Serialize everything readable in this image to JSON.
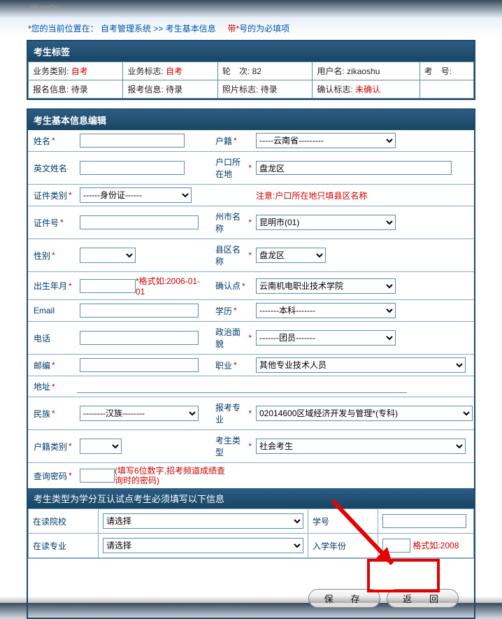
{
  "topuser": "zikaoshu、",
  "crumb": {
    "prefix": "*",
    "label": "您的当前位置在：",
    "p1": "自考管理系统",
    "sep": " >> ",
    "p2": "考生基本信息",
    "tail_star": "带*",
    "tail_text": "号的为必填项"
  },
  "tag": {
    "title": "考生标签",
    "r1": {
      "c1l": "业务类别:",
      "c1v": "自考",
      "c2l": "业务标志:",
      "c2v": "自考",
      "c3l": "轮　次:",
      "c3v": "82",
      "c4l": "用户名:",
      "c4v": "zikaoshu",
      "c5l": "考　号:",
      "c5v": ""
    },
    "r2": {
      "c1l": "报名信息:",
      "c1v": "待录",
      "c2l": "报考信息:",
      "c2v": "待录",
      "c3l": "照片标志:",
      "c3v": "待录",
      "c4l": "确认标志:",
      "c4v": "未确认",
      "c5l": "",
      "c5v": ""
    }
  },
  "edit": {
    "title": "考生基本信息编辑",
    "name_l": "姓名",
    "huji_l": "户籍",
    "huji_v": "-----云南省---------",
    "enname_l": "英文姓名",
    "hukou_l": "户口所在地",
    "hukou_v": "盘龙区",
    "idtype_l": "证件类别",
    "idtype_v": "------身份证------",
    "hukou_hint": "注意:户口所在地只填县区名称",
    "idno_l": "证件号",
    "city_l": "州市名称",
    "city_v": "昆明市(01)",
    "sex_l": "性别",
    "county_l": "县区名称",
    "county_v": "盘龙区",
    "birth_l": "出生年月",
    "birth_hint": "*格式如:2006-01-01",
    "confirm_l": "确认点",
    "confirm_v": "云南机电职业技术学院",
    "email_l": "Email",
    "edu_l": "学历",
    "edu_v": "-------本科-------",
    "tel_l": "电话",
    "pol_l": "政治面貌",
    "pol_v": "-------团员-------",
    "post_l": "邮编",
    "job_l": "职业",
    "job_v": "其他专业技术人员",
    "addr_l": "地址",
    "nation_l": "民族",
    "nation_v": "--------汉族--------",
    "major_l": "报考专业",
    "major_v": "02014600区域经济开发与管理*(专科)",
    "hujilb_l": "户籍类别",
    "kstype_l": "考生类型",
    "kstype_v": "社会考生",
    "pwd_l": "查询密码",
    "pwd_hint": "(填写6位数字,招考频道成绩查询时的密码)"
  },
  "sub": {
    "title": "考生类型为学分互认试点考生必须填写以下信息",
    "school_l": "在读院校",
    "school_v": "请选择",
    "stuid_l": "学号",
    "major_l": "在读专业",
    "major_v": "请选择",
    "year_l": "入学年份",
    "year_hint": "格式如:2008"
  },
  "btn": {
    "save": "保　存",
    "back": "返　回"
  }
}
